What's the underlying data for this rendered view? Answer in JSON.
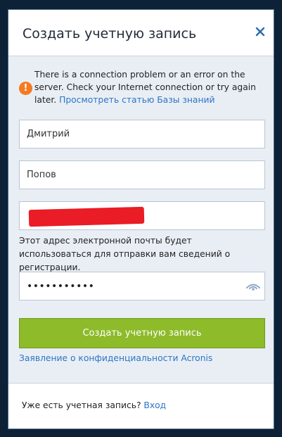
{
  "dialog": {
    "title": "Создать учетную запись"
  },
  "notice": {
    "message": "There is a connection problem or an error on the server. Check your Internet connection or try again later.",
    "link_label": "Просмотреть статью Базы знаний"
  },
  "form": {
    "first_name": "Дмитрий",
    "last_name": "Попов",
    "email_hint": "Этот адрес электронной почты будет использоваться для отправки вам сведений о регистрации.",
    "password_mask": "•••••••••••",
    "submit_label": "Создать учетную запись",
    "privacy_label": "Заявление о конфиденциальности Acronis"
  },
  "footer": {
    "question": "Уже есть учетная запись?",
    "login_label": "Вход"
  },
  "colors": {
    "submit": "#8dbb2a",
    "link": "#2b75c2",
    "warning": "#f47b20",
    "redaction": "#ea1c25"
  }
}
